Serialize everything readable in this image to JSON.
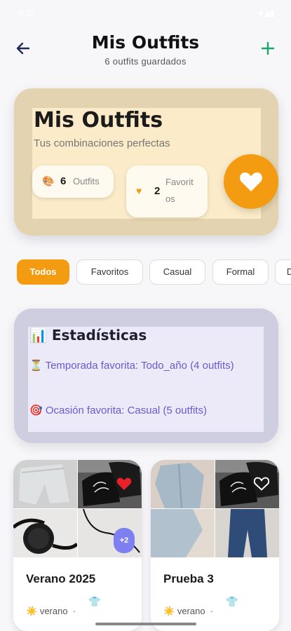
{
  "status_bar": {
    "time": "9:30",
    "signal": "▾◢▮"
  },
  "header": {
    "title": "Mis Outfits",
    "subtitle": "6 outfits guardados"
  },
  "hero": {
    "title": "Mis Outfits",
    "subtitle": "Tus combinaciones perfectas",
    "outfits_count": "6",
    "outfits_label": "Outfits",
    "favorites_count": "2",
    "favorites_label": "Favoritos"
  },
  "filters": [
    "Todos",
    "Favoritos",
    "Casual",
    "Formal",
    "Deporte"
  ],
  "stats": {
    "title": "📊 Estadísticas",
    "season": "⏳ Temporada favorita: Todo_año (4 outfits)",
    "occasion": "🎯 Ocasión favorita: Casual (5 outfits)"
  },
  "outfits": [
    {
      "name": "Verano 2025",
      "season": "verano",
      "more": "+2",
      "favorite": true
    },
    {
      "name": "Prueba 3",
      "season": "verano",
      "favorite": false
    }
  ],
  "colors": {
    "accent": "#f39c12",
    "stats_text": "#6a5acd",
    "badge": "#7e7ff0",
    "heart_fav": "#e8202a"
  }
}
